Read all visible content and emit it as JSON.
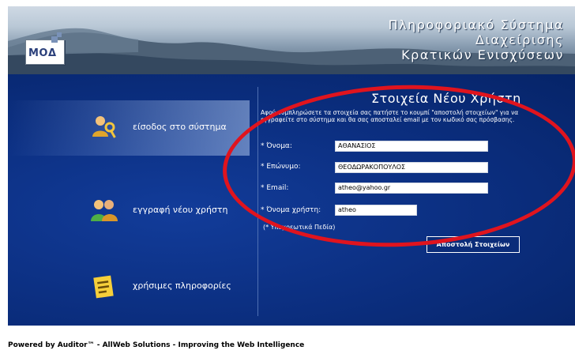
{
  "header": {
    "logo_text": "ΜΟΔ",
    "title_lines": [
      "Πληροφοριακό Σύστημα",
      "Διαχείρισης",
      "Κρατικών Ενισχύσεων"
    ]
  },
  "nav": {
    "items": [
      {
        "label": "είσοδος στο σύστημα",
        "icon": "key-user-icon",
        "active": true
      },
      {
        "label": "εγγραφή νέου χρήστη",
        "icon": "users-icon",
        "active": false
      },
      {
        "label": "χρήσιμες πληροφορίες",
        "icon": "document-icon",
        "active": false
      }
    ]
  },
  "form": {
    "title": "Στοιχεία Νέου Χρήστη",
    "description": "Αφού συμπληρώσετε τα στοιχεία σας πατήστε το κουμπί \"αποστολή στοιχείων\" για να εγγραφείτε στο σύστημα και θα σας αποσταλεί email με τον κωδικό σας πρόσβασης.",
    "fields": [
      {
        "label": "* Όνομα:",
        "value": "ΑΘΑΝΑΣΙΟΣ"
      },
      {
        "label": "* Επώνυμο:",
        "value": "ΘΕΟΔΩΡΑΚΟΠΟΥΛΟΣ"
      },
      {
        "label": "* Email:",
        "value": "atheo@yahoo.gr"
      },
      {
        "label": "* Όνομα χρήστη:",
        "value": "atheo"
      }
    ],
    "required_note": "(* Υποχρεωτικά Πεδία)",
    "submit_label": "Αποστολή Στοιχείων"
  },
  "footer": {
    "text": "Powered by Auditor™ - AllWeb Solutions - Improving the Web Intelligence"
  },
  "colors": {
    "panel": "#0b2e7f",
    "annotation": "#e0141e",
    "header": "#8ea2b6"
  }
}
